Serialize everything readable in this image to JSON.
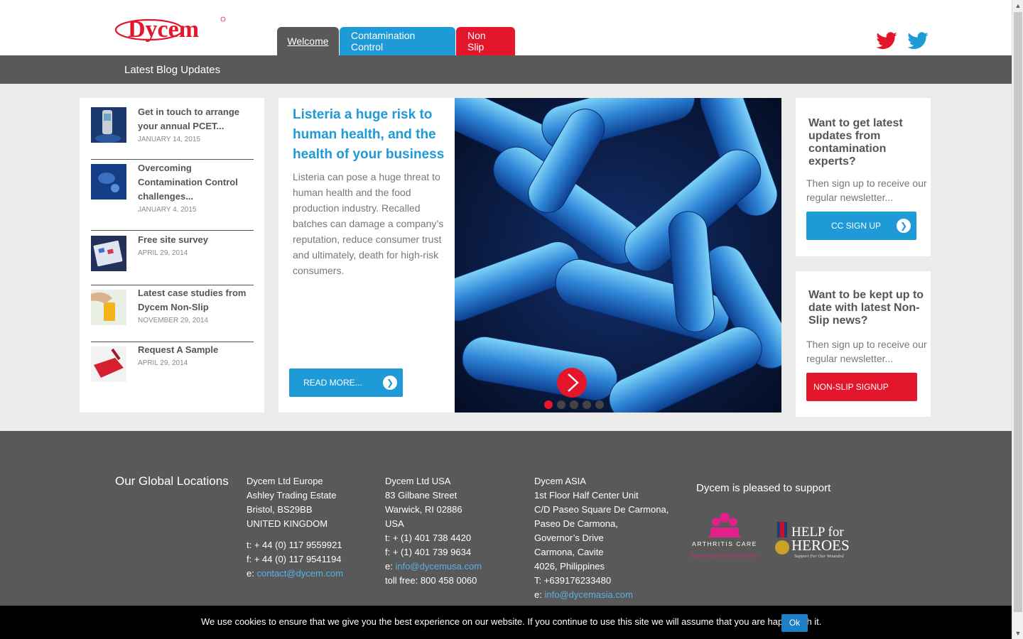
{
  "header": {
    "logo_text": "Dycem",
    "nav": [
      {
        "label": "Welcome"
      },
      {
        "label": "Contamination Control"
      },
      {
        "label": "Non Slip"
      }
    ]
  },
  "bar": {
    "title": "Latest Blog Updates"
  },
  "blog": {
    "items": [
      {
        "title": "Get in touch to arrange your annual PCET...",
        "date": "JANUARY 14, 2015"
      },
      {
        "title": "Overcoming Contamination Control challenges...",
        "date": "JANUARY 4, 2015"
      },
      {
        "title": "Free site survey",
        "date": "APRIL 29, 2014"
      },
      {
        "title": "Latest case studies from Dycem Non-Slip",
        "date": "NOVEMBER 29, 2014"
      },
      {
        "title": "Request A Sample",
        "date": "APRIL 29, 2014"
      }
    ]
  },
  "feature": {
    "title": "Listeria a huge risk to human health, and the health of your business",
    "body": "Listeria can pose a huge threat to human health and the food production industry. Recalled batches can damage a company’s reputation, reduce consumer trust and ultimately, death for high-risk consumers.",
    "read_more": "READ MORE...",
    "slide_count": 5,
    "active_slide": 1
  },
  "panels": {
    "cc": {
      "title": "Want to get latest updates from contamination experts?",
      "text": "Then sign up to receive our regular newsletter...",
      "button": "CC SIGN UP"
    },
    "ns": {
      "title": "Want to be kept up to date with latest Non-Slip news?",
      "text": "Then sign up to receive our regular newsletter...",
      "button": "NON-SLIP SIGNUP"
    }
  },
  "footer": {
    "heading": "Our Global Locations",
    "europe": {
      "name": "Dycem Ltd Europe",
      "line1": "Ashley Trading Estate",
      "line2": "Bristol, BS29BB",
      "line3": "UNITED KINGDOM",
      "tel": "t: + 44 (0) 117 9559921",
      "fax": "f: + 44 (0) 117 9541194",
      "email_prefix": "e: ",
      "email": "contact@dycem.com"
    },
    "usa": {
      "name": "Dycem Ltd USA",
      "line1": "83 Gilbane Street",
      "line2": "Warwick, RI 02886",
      "line3": "USA",
      "tel": "t: + (1) 401 738 4420",
      "fax": "f: + (1) 401 739 9634",
      "email_prefix": "e: ",
      "email": "info@dycemusa.com",
      "tollfree": "toll free: 800 458 0060"
    },
    "asia": {
      "name": "Dycem ASIA",
      "line1": "1st Floor Half Center Unit",
      "line2": "C/D Paseo Square De Carmona,",
      "line3": "Paseo De Carmona,",
      "line4": "Governor’s Drive",
      "line5": "Carmona, Cavite",
      "line6": "4026, Philippines",
      "tel": "T: +639176233480",
      "email_prefix": "e: ",
      "email": "info@dycemasia.com"
    },
    "support_heading": "Dycem is pleased to support",
    "charity1": {
      "name": "ARTHRITIS CARE",
      "tagline": "Empowering people with arthritis"
    },
    "charity2": {
      "line1": "HELP for",
      "line2": "HEROES",
      "tagline": "Support For Our Wounded"
    }
  },
  "cookie": {
    "text": "We use cookies to ensure that we give you the best experience on our website. If you continue to use this site we will assume that you are happy with it.",
    "ok": "Ok"
  },
  "colors": {
    "brand_red": "#e3162b",
    "brand_blue": "#1e9ad6",
    "dark_grey": "#595959"
  }
}
